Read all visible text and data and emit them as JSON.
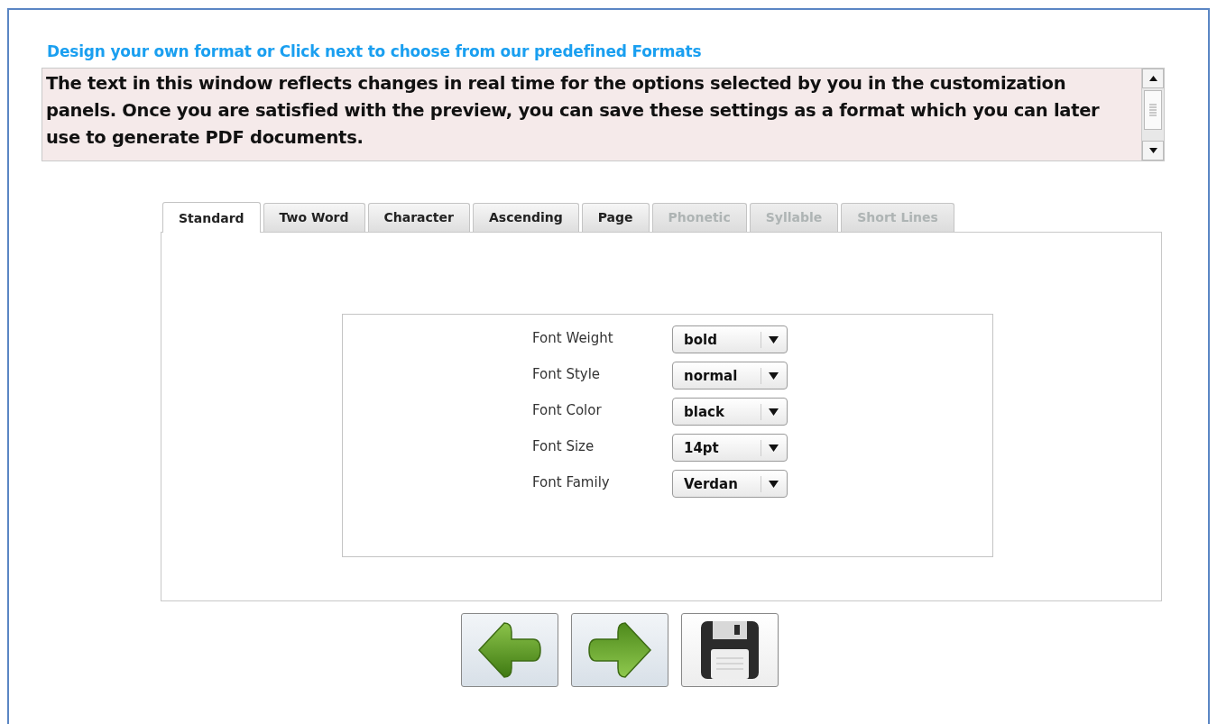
{
  "heading": "Design your own format or Click next to choose from our predefined Formats",
  "preview": {
    "text": "The text in this window reflects changes in real time for the options selected by you in the customization panels. Once you are satisfied with the preview, you can save these settings as a format which you can later use to generate PDF documents."
  },
  "tabs": [
    {
      "label": "Standard",
      "selected": true,
      "disabled": false
    },
    {
      "label": "Two Word",
      "selected": false,
      "disabled": false
    },
    {
      "label": "Character",
      "selected": false,
      "disabled": false
    },
    {
      "label": "Ascending",
      "selected": false,
      "disabled": false
    },
    {
      "label": "Page",
      "selected": false,
      "disabled": false
    },
    {
      "label": "Phonetic",
      "selected": false,
      "disabled": true
    },
    {
      "label": "Syllable",
      "selected": false,
      "disabled": true
    },
    {
      "label": "Short Lines",
      "selected": false,
      "disabled": true
    }
  ],
  "settings": [
    {
      "label": "Font Weight",
      "value": "bold"
    },
    {
      "label": "Font Style",
      "value": "normal"
    },
    {
      "label": "Font Color",
      "value": "black"
    },
    {
      "label": "Font Size",
      "value": "14pt"
    },
    {
      "label": "Font Family",
      "value": "Verdan"
    }
  ],
  "buttons": [
    {
      "kind": "back"
    },
    {
      "kind": "next"
    },
    {
      "kind": "save"
    }
  ]
}
